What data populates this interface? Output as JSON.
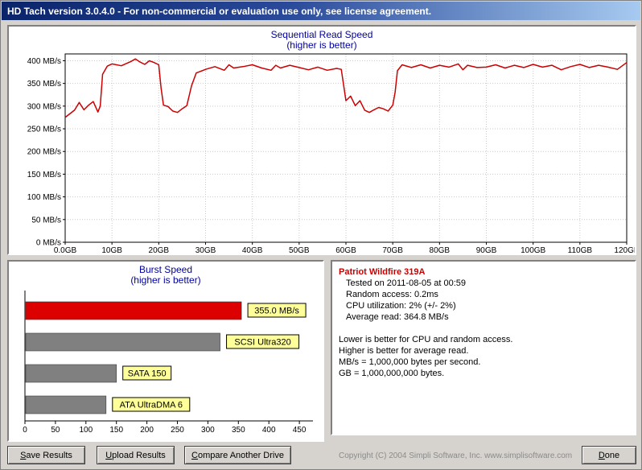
{
  "title_bar": {
    "title": "HD Tach version 3.0.4.0  - For non-commercial or evaluation use only, see license agreement."
  },
  "info_panel": {
    "drive_name": "Patriot Wildfire 319A",
    "name_color": "#cc0000",
    "lines": [
      "Tested on 2011-08-05 at 00:59",
      "Random access: 0.2ms",
      "CPU utilization: 2% (+/- 2%)",
      "Average read: 364.8 MB/s"
    ],
    "notes": [
      "Lower is better for CPU and random access.",
      "Higher is better for average read.",
      "MB/s = 1,000,000 bytes per second.",
      "GB = 1,000,000,000 bytes."
    ]
  },
  "buttons": {
    "save": {
      "accel": "S",
      "rest": "ave Results"
    },
    "upload": {
      "accel": "U",
      "rest": "pload Results"
    },
    "compare": {
      "accel": "C",
      "rest": "ompare Another Drive"
    },
    "done": {
      "accel": "D",
      "rest": "one"
    }
  },
  "footer": {
    "copyright": "Copyright (C) 2004 Simpli Software, Inc. www.simplisoftware.com"
  },
  "colors": {
    "chart_title": "#0000a0",
    "line_red": "#cc0000",
    "bar_red": "#dd0000",
    "bar_gray": "#808080",
    "label_yellow": "#ffff99"
  },
  "chart_data": [
    {
      "type": "line",
      "title": "Sequential Read Speed",
      "subtitle": "(higher is better)",
      "xlim": [
        0,
        120
      ],
      "ylim": [
        0,
        415
      ],
      "grid": true,
      "x_tick_values": [
        0,
        10,
        20,
        30,
        40,
        50,
        60,
        70,
        80,
        90,
        100,
        110,
        120
      ],
      "x_tick_labels": [
        "0.0GB",
        "10GB",
        "20GB",
        "30GB",
        "40GB",
        "50GB",
        "60GB",
        "70GB",
        "80GB",
        "90GB",
        "100GB",
        "110GB",
        "120GB"
      ],
      "y_tick_values": [
        0,
        50,
        100,
        150,
        200,
        250,
        300,
        350,
        400
      ],
      "y_tick_labels": [
        "0 MB/s",
        "50 MB/s",
        "100 MB/s",
        "150 MB/s",
        "200 MB/s",
        "250 MB/s",
        "300 MB/s",
        "350 MB/s",
        "400 MB/s"
      ],
      "line_color": "#cc0000",
      "x": [
        0,
        1,
        2,
        3,
        4,
        5,
        6,
        7,
        7.5,
        8,
        9,
        10,
        12,
        14,
        15,
        16,
        17,
        18,
        19,
        20,
        20.5,
        21,
        22,
        23,
        24,
        25,
        26,
        27,
        28,
        30,
        32,
        34,
        35,
        36,
        38,
        40,
        42,
        44,
        45,
        46,
        48,
        50,
        52,
        54,
        56,
        58,
        59,
        60,
        61,
        62,
        63,
        64,
        65,
        66,
        67,
        68,
        69,
        70,
        70.5,
        71,
        72,
        74,
        76,
        78,
        80,
        82,
        84,
        85,
        86,
        88,
        90,
        92,
        94,
        96,
        98,
        100,
        102,
        104,
        106,
        108,
        110,
        112,
        114,
        116,
        118,
        120
      ],
      "y": [
        275,
        283,
        291,
        308,
        292,
        302,
        310,
        287,
        300,
        370,
        388,
        393,
        389,
        398,
        404,
        397,
        392,
        400,
        396,
        391,
        340,
        302,
        299,
        289,
        286,
        294,
        301,
        345,
        373,
        381,
        387,
        379,
        391,
        384,
        387,
        391,
        384,
        379,
        390,
        384,
        390,
        385,
        380,
        386,
        379,
        383,
        381,
        312,
        322,
        301,
        312,
        291,
        286,
        292,
        297,
        294,
        289,
        302,
        330,
        378,
        391,
        385,
        391,
        384,
        390,
        386,
        393,
        380,
        390,
        385,
        386,
        391,
        384,
        390,
        385,
        392,
        386,
        390,
        380,
        387,
        392,
        385,
        390,
        386,
        381,
        396
      ]
    },
    {
      "type": "bar",
      "orientation": "horizontal",
      "title": "Burst Speed",
      "subtitle": "(higher is better)",
      "xlim": [
        0,
        475
      ],
      "x_tick_values": [
        0,
        50,
        100,
        150,
        200,
        250,
        300,
        350,
        400,
        450
      ],
      "categories": [
        "355.0 MB/s",
        "SCSI Ultra320",
        "SATA 150",
        "ATA UltraDMA 6"
      ],
      "values": [
        355,
        320,
        150,
        133
      ],
      "bar_colors": [
        "#dd0000",
        "#808080",
        "#808080",
        "#808080"
      ],
      "label_bg": "#ffff99"
    }
  ]
}
